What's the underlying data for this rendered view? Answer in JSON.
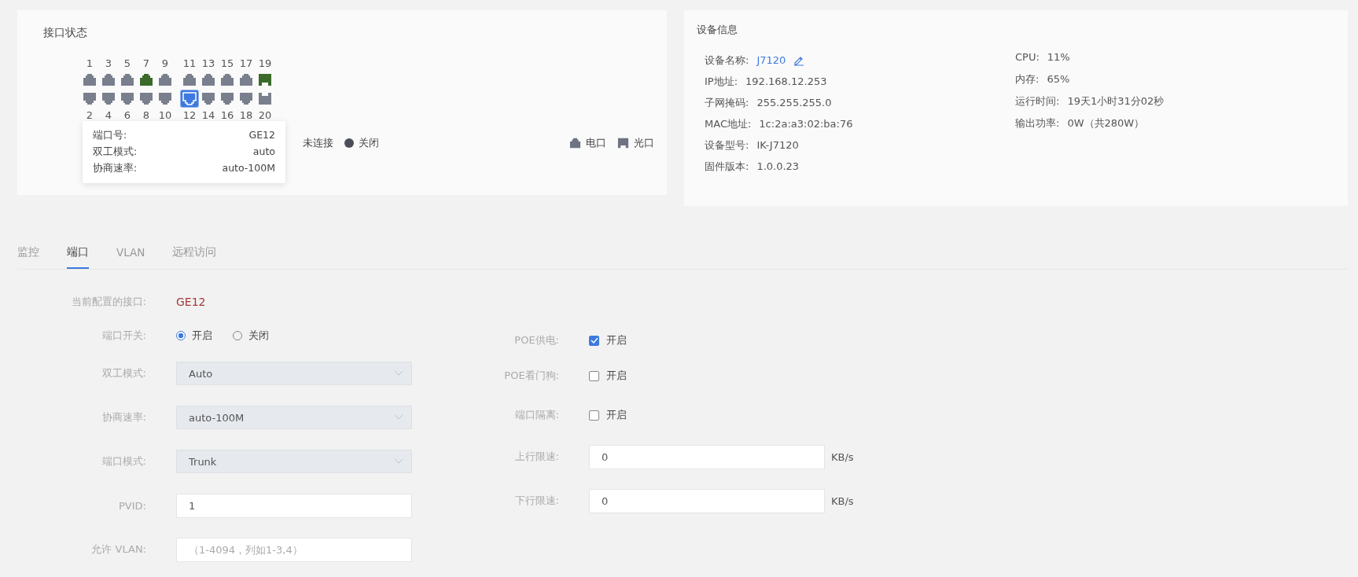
{
  "port_panel": {
    "title": "接口状态",
    "ports": [
      {
        "label": "1",
        "kind": "electric",
        "connected": false,
        "selected": false
      },
      {
        "label": "2",
        "kind": "electric",
        "connected": false,
        "selected": false
      },
      {
        "label": "3",
        "kind": "electric",
        "connected": false,
        "selected": false
      },
      {
        "label": "4",
        "kind": "electric",
        "connected": false,
        "selected": false
      },
      {
        "label": "5",
        "kind": "electric",
        "connected": false,
        "selected": false
      },
      {
        "label": "6",
        "kind": "electric",
        "connected": false,
        "selected": false
      },
      {
        "label": "7",
        "kind": "electric",
        "connected": true,
        "selected": false
      },
      {
        "label": "8",
        "kind": "electric",
        "connected": false,
        "selected": false
      },
      {
        "label": "9",
        "kind": "electric",
        "connected": false,
        "selected": false
      },
      {
        "label": "10",
        "kind": "electric",
        "connected": false,
        "selected": false
      },
      {
        "label": "11",
        "kind": "electric",
        "connected": false,
        "selected": false
      },
      {
        "label": "12",
        "kind": "electric",
        "connected": false,
        "selected": true
      },
      {
        "label": "13",
        "kind": "electric",
        "connected": false,
        "selected": false
      },
      {
        "label": "14",
        "kind": "electric",
        "connected": false,
        "selected": false
      },
      {
        "label": "15",
        "kind": "electric",
        "connected": false,
        "selected": false
      },
      {
        "label": "16",
        "kind": "electric",
        "connected": false,
        "selected": false
      },
      {
        "label": "17",
        "kind": "electric",
        "connected": false,
        "selected": false
      },
      {
        "label": "18",
        "kind": "electric",
        "connected": false,
        "selected": false
      },
      {
        "label": "19",
        "kind": "optical",
        "connected": true,
        "selected": false
      },
      {
        "label": "20",
        "kind": "optical",
        "connected": false,
        "selected": false
      }
    ],
    "tooltip": [
      {
        "label": "端口号:",
        "value": "GE12"
      },
      {
        "label": "双工模式:",
        "value": "auto"
      },
      {
        "label": "协商速率:",
        "value": "auto-100M"
      }
    ],
    "status_legend": [
      {
        "label": "未连接"
      },
      {
        "label": "关闭",
        "color": "#4a4f5a"
      }
    ],
    "type_legend": [
      {
        "label": "电口",
        "kind": "electric"
      },
      {
        "label": "光口",
        "kind": "optical"
      }
    ]
  },
  "device_info": {
    "title": "设备信息",
    "left": [
      {
        "label": "设备名称:",
        "value": "J7120",
        "kind": "editable"
      },
      {
        "label": "IP地址:",
        "value": "192.168.12.253"
      },
      {
        "label": "子网掩码:",
        "value": "255.255.255.0"
      },
      {
        "label": "MAC地址:",
        "value": "1c:2a:a3:02:ba:76"
      },
      {
        "label": "设备型号:",
        "value": "IK-J7120"
      },
      {
        "label": "固件版本:",
        "value": "1.0.0.23"
      }
    ],
    "right": [
      {
        "label": "CPU:",
        "value": "11%"
      },
      {
        "label": "内存:",
        "value": "65%"
      },
      {
        "label": "运行时间:",
        "value": "19天1小时31分02秒"
      },
      {
        "label": "输出功率:",
        "value": "0W（共280W）"
      }
    ]
  },
  "tabs": [
    {
      "label": "监控",
      "selected": false
    },
    {
      "label": "端口",
      "selected": true
    },
    {
      "label": "VLAN",
      "selected": false
    },
    {
      "label": "远程访问",
      "selected": false
    }
  ],
  "form": {
    "current": {
      "label": "当前配置的接口:",
      "value": "GE12"
    },
    "left": [
      {
        "kind": "radio",
        "label": "端口开关:",
        "options": [
          {
            "label": "开启",
            "selected": true
          },
          {
            "label": "关闭",
            "selected": false
          }
        ]
      },
      {
        "kind": "select",
        "label": "双工模式:",
        "value": "Auto"
      },
      {
        "kind": "select",
        "label": "协商速率:",
        "value": "auto-100M"
      },
      {
        "kind": "select",
        "label": "端口模式:",
        "value": "Trunk"
      },
      {
        "kind": "input",
        "label": "PVID:",
        "value": "1"
      },
      {
        "kind": "input",
        "label": "允许 VLAN:",
        "placeholder": "（1-4094，列如1-3,4）"
      }
    ],
    "right": [
      {
        "kind": "checkbox",
        "label": "POE供电:",
        "text": "开启",
        "checked": true
      },
      {
        "kind": "checkbox",
        "label": "POE看门狗:",
        "text": "开启",
        "checked": false
      },
      {
        "kind": "checkbox",
        "label": "端口隔离:",
        "text": "开启",
        "checked": false
      },
      {
        "kind": "input",
        "label": "上行限速:",
        "value": "0",
        "unit": "KB/s"
      },
      {
        "kind": "input",
        "label": "下行限速:",
        "value": "0",
        "unit": "KB/s"
      }
    ]
  }
}
